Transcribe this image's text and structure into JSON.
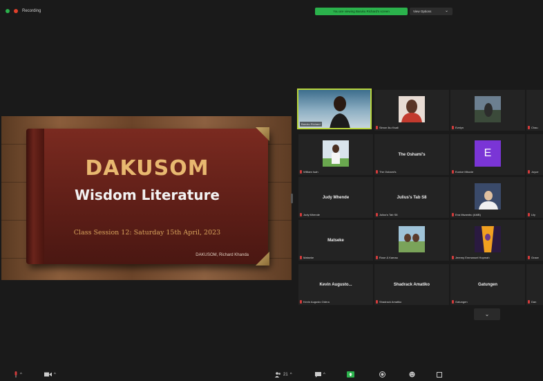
{
  "topbar": {
    "recording_label": "Recording",
    "viewing_banner": "You are viewing Baruku Richard's screen",
    "view_options_label": "View Options",
    "status_colors": {
      "live": "#2bb24c",
      "rec": "#e0402b"
    }
  },
  "slide": {
    "title": "DAKUSOM",
    "subtitle": "Wisdom Literature",
    "session": "Class Session 12: Saturday 15th April, 2023",
    "credit": "DAKUSOM, Richard Khanda"
  },
  "gallery": {
    "tiles": [
      {
        "label": "Baruku Richard",
        "type": "video"
      },
      {
        "label": "Simon Iku Ksali",
        "type": "photo"
      },
      {
        "label": "Evelyn",
        "type": "photo"
      },
      {
        "label": "Chau",
        "type": "partial"
      },
      {
        "label": "William Isah",
        "type": "photo"
      },
      {
        "name": "The Oshami's",
        "label": "The Oshami's",
        "type": "name"
      },
      {
        "avatar": "E",
        "label": "Eunice Mbuvie",
        "type": "avatar"
      },
      {
        "label": "Joyce",
        "type": "partial"
      },
      {
        "name": "Judy Mhende",
        "label": "Judy Mhende",
        "type": "name"
      },
      {
        "name": "Julius's Tab S8",
        "label": "Julius's Tab S8",
        "type": "name"
      },
      {
        "label": "Ena Mwambu (AMB)",
        "type": "photo"
      },
      {
        "label": "Lily",
        "type": "partial"
      },
      {
        "name": "Matseke",
        "label": "Matseke",
        "type": "name"
      },
      {
        "label": "Rose & Kamau",
        "type": "photo"
      },
      {
        "label": "Jeremy Emmanuel Hopmah",
        "type": "photo"
      },
      {
        "label": "Grace",
        "type": "partial"
      },
      {
        "name": "Kevin Augusto...",
        "label": "Kevin Augusto Odera",
        "type": "name"
      },
      {
        "name": "Shadrack Amatiko",
        "label": "Shadrack Amatiko",
        "type": "name"
      },
      {
        "name": "Gatungen",
        "label": "Gatungen",
        "type": "name"
      },
      {
        "label": "Dan",
        "type": "partial"
      }
    ],
    "expand_icon": "chevron-down-icon"
  },
  "toolbar": {
    "items": [
      {
        "icon": "microphone-icon",
        "caret": "^"
      },
      {
        "icon": "video-camera-icon",
        "caret": "^"
      },
      {
        "icon": "participants-icon",
        "count": "21",
        "caret": "^"
      },
      {
        "icon": "chat-icon",
        "caret": "^"
      },
      {
        "icon": "share-screen-icon"
      },
      {
        "icon": "record-icon"
      },
      {
        "icon": "reactions-icon"
      },
      {
        "icon": "apps-icon"
      }
    ]
  }
}
